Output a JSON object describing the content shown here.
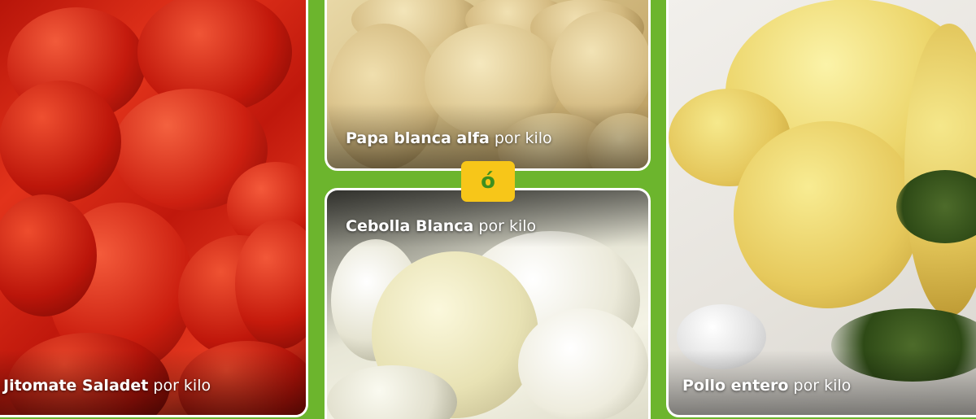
{
  "products": [
    {
      "name": "Jitomate Saladet",
      "unit": "por kilo"
    },
    {
      "name": "Papa blanca alfa",
      "unit": "por kilo"
    },
    {
      "name": "Cebolla Blanca",
      "unit": "por kilo"
    },
    {
      "name": "Pollo entero",
      "unit": "por kilo"
    }
  ],
  "separator_label": "ó",
  "colors": {
    "background": "#6cb52d",
    "badge": "#f7c619",
    "badge_text": "#3f8f1e",
    "label_text": "#ffffff"
  }
}
